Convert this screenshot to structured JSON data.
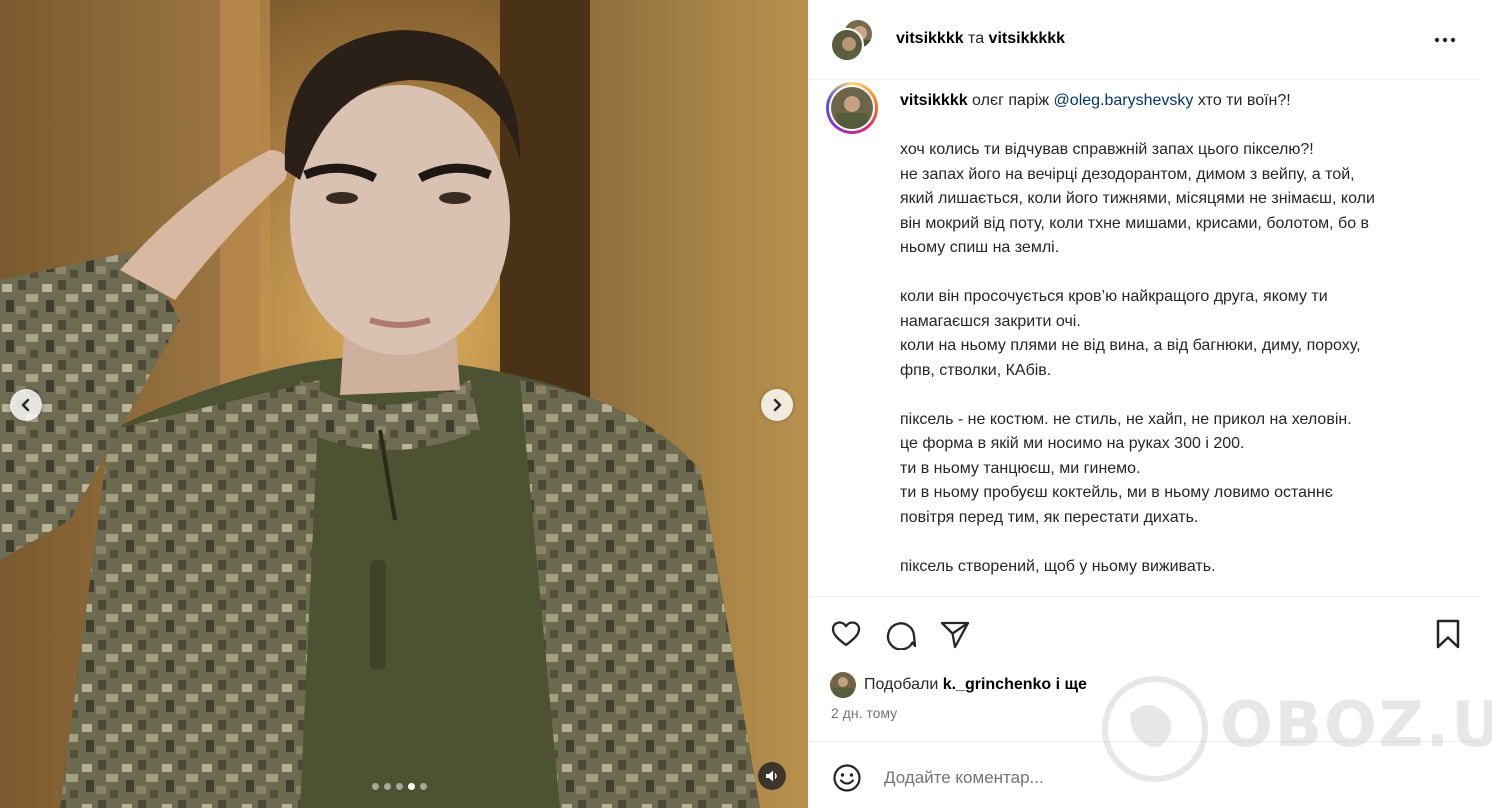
{
  "media": {
    "slide_count": 5,
    "active_slide_index": 3
  },
  "header": {
    "user1": "vitsikkkk",
    "and_word": " та ",
    "user2": "vitsikkkkk"
  },
  "caption": {
    "username": "vitsikkkk",
    "intro": " олєг паріж ",
    "mention": "@oleg.baryshevsky",
    "intro_end": " хто ти воїн?!",
    "paragraphs": [
      [
        "хоч колись ти відчував справжній запах цього пікселю?!",
        "не запах його на вечірці дезодорантом, димом з вейпу, а той,",
        "який лишається, коли його тижнями, місяцями не знімаєш, коли",
        "він мокрий від поту, коли тхне мишами, крисами, болотом, бо в",
        "ньому спиш на землі."
      ],
      [
        "коли він просочується кров’ю найкращого друга, якому ти",
        "намагаєшся закрити очі.",
        "коли на ньому плями не від вина, а від багнюки, диму, пороху,",
        "фпв, стволки, КАбів."
      ],
      [
        "піксель - не костюм. не стиль, не хайп, не прикол на хеловін.",
        "це форма в якій ми носимо на руках 300 і 200.",
        "ти в ньому танцюєш, ми гинемо.",
        "ти в ньому пробуєш коктейль, ми в ньому ловимо останнє",
        "повітря перед тим, як перестати дихать."
      ],
      [
        "піксель створений, щоб у ньому виживать."
      ]
    ]
  },
  "likes": {
    "prefix": "Подобали ",
    "user": "k._grinchenko",
    "suffix": " і ще"
  },
  "timestamp": "2 дн. тому",
  "comment": {
    "placeholder": "Додайте коментар..."
  },
  "watermark": "OBOZ.UA",
  "icons": {
    "nav_prev": "chevron-left-icon",
    "nav_next": "chevron-right-icon",
    "sound": "speaker-icon",
    "more": "more-horizontal-icon",
    "like": "heart-icon",
    "comment": "comment-bubble-icon",
    "share": "paper-plane-icon",
    "save": "bookmark-icon",
    "emoji": "smiley-icon"
  },
  "colors": {
    "mention": "#00376b",
    "secondary_text": "#737373",
    "divider": "#efefef"
  }
}
